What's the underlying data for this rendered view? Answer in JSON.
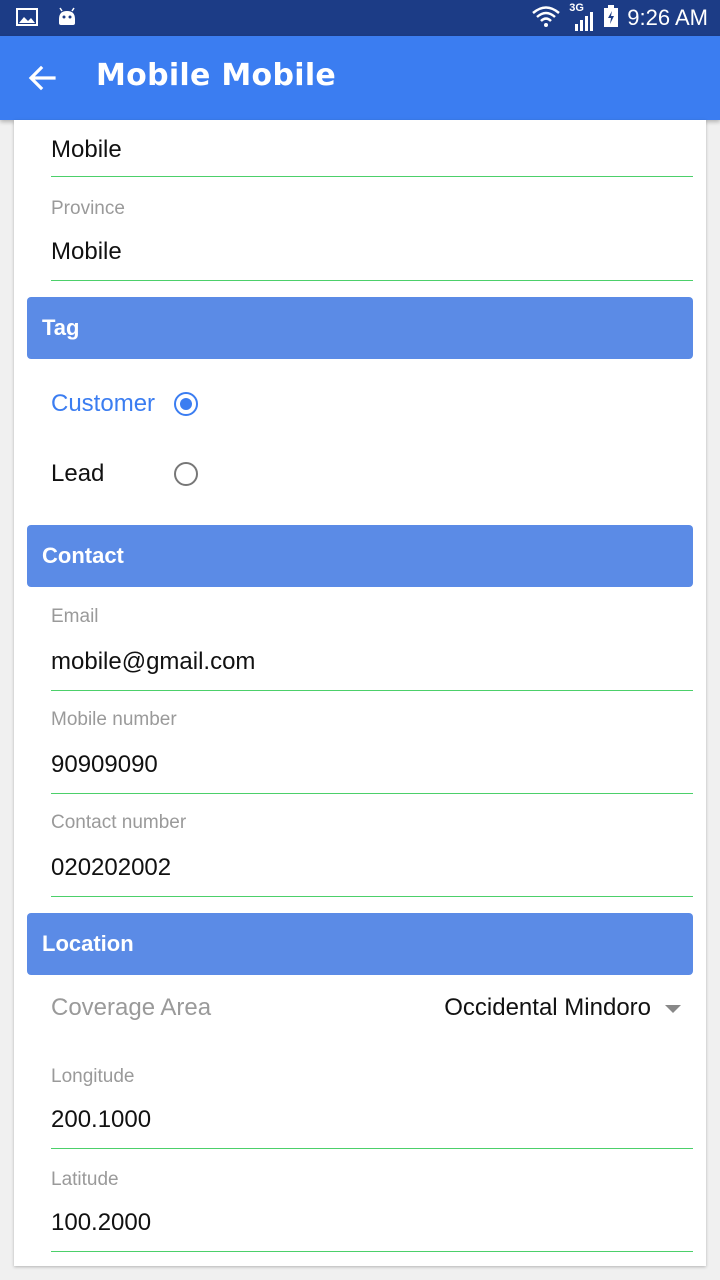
{
  "status_bar": {
    "time": "9:26 AM",
    "network": "3G",
    "icons": [
      "image-icon",
      "android-icon",
      "wifi-icon",
      "signal-icon",
      "battery-icon"
    ]
  },
  "app_bar": {
    "title": "Mobile Mobile",
    "back_icon": "back-arrow-icon"
  },
  "address": {
    "city_value": "Mobile",
    "province_label": "Province",
    "province_value": "Mobile"
  },
  "tag": {
    "header": "Tag",
    "options": [
      {
        "label": "Customer",
        "selected": true
      },
      {
        "label": "Lead",
        "selected": false
      }
    ]
  },
  "contact": {
    "header": "Contact",
    "email_label": "Email",
    "email_value": "mobile@gmail.com",
    "mobile_label": "Mobile number",
    "mobile_value": "90909090",
    "contact_label": "Contact number",
    "contact_value": "020202002"
  },
  "location": {
    "header": "Location",
    "coverage_label": "Coverage Area",
    "coverage_value": "Occidental Mindoro",
    "longitude_label": "Longitude",
    "longitude_value": "200.1000",
    "latitude_label": "Latitude",
    "latitude_value": "100.2000"
  },
  "colors": {
    "status_bar": "#1c3c86",
    "app_bar": "#3b7df1",
    "section_header": "#5b8be6",
    "field_underline": "#4cd06a",
    "selected_radio": "#3b7df1"
  }
}
